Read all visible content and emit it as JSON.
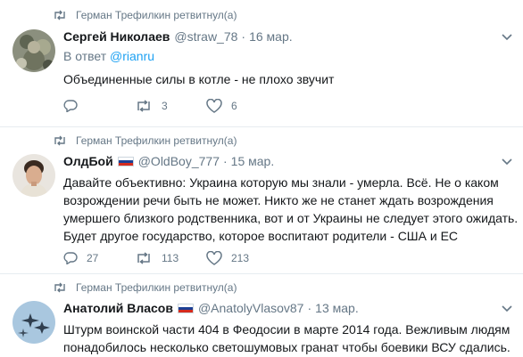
{
  "tweets": [
    {
      "context": "Герман Трефилкин ретвитнул(а)",
      "name": "Сергей Николаев",
      "handle": "@straw_78",
      "separator": "·",
      "date": "16 мар.",
      "reply_prefix": "В ответ",
      "reply_to": "@rianru",
      "text": "Объединенные силы в котле - не плохо звучит",
      "reply_count": "",
      "retweet_count": "3",
      "like_count": "6"
    },
    {
      "context": "Герман Трефилкин ретвитнул(а)",
      "name": "ОлдБой",
      "handle": "@OldBoy_777",
      "separator": "·",
      "date": "15 мар.",
      "text": "Давайте объективно: Украина которую мы знали - умерла. Всё. Не о каком возрождении речи быть не может. Никто же не станет ждать возрождения умершего близкого родственника, вот и от Украины не следует этого ожидать. Будет другое государство, которое воспитают родители - США и ЕС",
      "reply_count": "27",
      "retweet_count": "113",
      "like_count": "213"
    },
    {
      "context": "Герман Трефилкин ретвитнул(а)",
      "name": "Анатолий Власов",
      "handle": "@AnatolyVlasov87",
      "separator": "·",
      "date": "13 мар.",
      "text": "Штурм воинской части 404 в Феодосии в марте 2014 года. Вежливым людям понадобилось несколько светошумовых гранат чтобы боевики ВСУ сдались."
    }
  ],
  "colors": {
    "link": "#1da1f2",
    "muted": "#657786",
    "text": "#14171a",
    "divider": "#e6ecf0"
  },
  "icons": [
    "retweet-icon",
    "reply-icon",
    "like-icon",
    "chevron-down-icon",
    "russian-flag-icon"
  ]
}
